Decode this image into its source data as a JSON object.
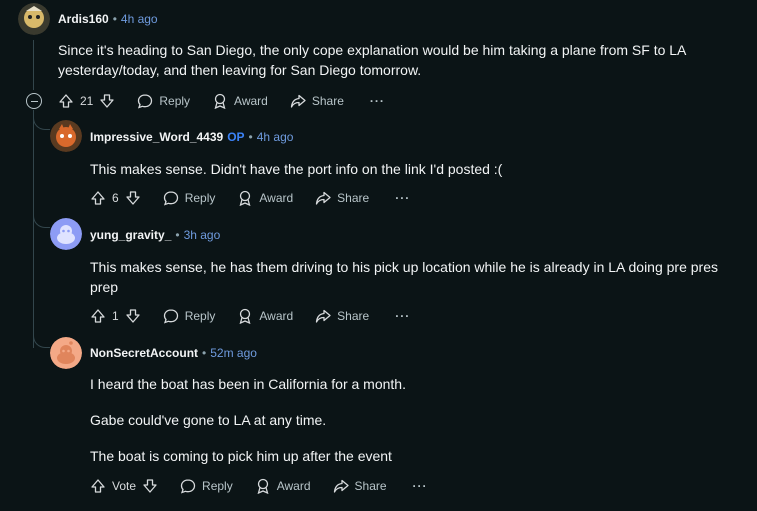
{
  "comments": [
    {
      "author": "Ardis160",
      "time": "4h ago",
      "body": [
        "Since it's heading to San Diego, the only cope explanation would be him taking a plane from SF to LA yesterday/today, and then leaving for San Diego tomorrow."
      ],
      "votes": "21",
      "avatar_color": "#d8b96a"
    },
    {
      "author": "Impressive_Word_4439",
      "op": "OP",
      "time": "4h ago",
      "body": [
        "This makes sense. Didn't have the port info on the link I'd posted :("
      ],
      "votes": "6",
      "avatar_color": "#d9692c"
    },
    {
      "author": "yung_gravity_",
      "time": "3h ago",
      "body": [
        "This makes sense, he has them driving to his pick up location while he is already in LA doing pre pres prep"
      ],
      "votes": "1",
      "avatar_color": "#8d9cf5"
    },
    {
      "author": "NonSecretAccount",
      "time": "52m ago",
      "body": [
        "I heard the boat has been in California for a month.",
        "Gabe could've gone to LA at any time.",
        "The boat is coming to pick him up after the event"
      ],
      "votes": "Vote",
      "avatar_color": "#f4a987"
    }
  ],
  "actions": {
    "reply": "Reply",
    "award": "Award",
    "share": "Share",
    "more": "···"
  },
  "colors": {
    "background": "#0b1416",
    "link": "#6f9bde",
    "op": "#3b82f6"
  }
}
